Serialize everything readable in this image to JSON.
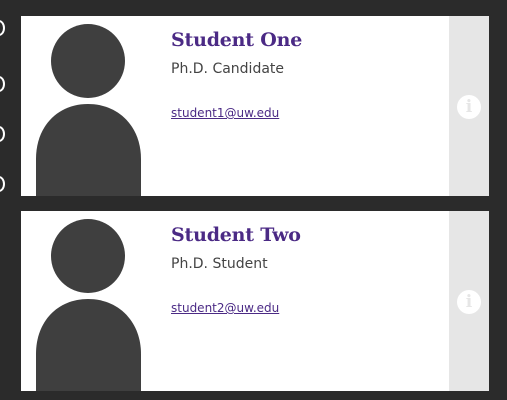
{
  "students": [
    {
      "name": "Student One",
      "title": "Ph.D. Candidate",
      "email": "student1@uw.edu",
      "info_icon": "info-icon",
      "info_glyph": "i"
    },
    {
      "name": "Student Two",
      "title": "Ph.D. Student",
      "email": "student2@uw.edu",
      "info_icon": "info-icon",
      "info_glyph": "i"
    }
  ],
  "colors": {
    "background": "#2b2b2b",
    "name": "#4b2a85",
    "avatar": "#3f3f3f",
    "sidebar": "#e6e6e6"
  }
}
